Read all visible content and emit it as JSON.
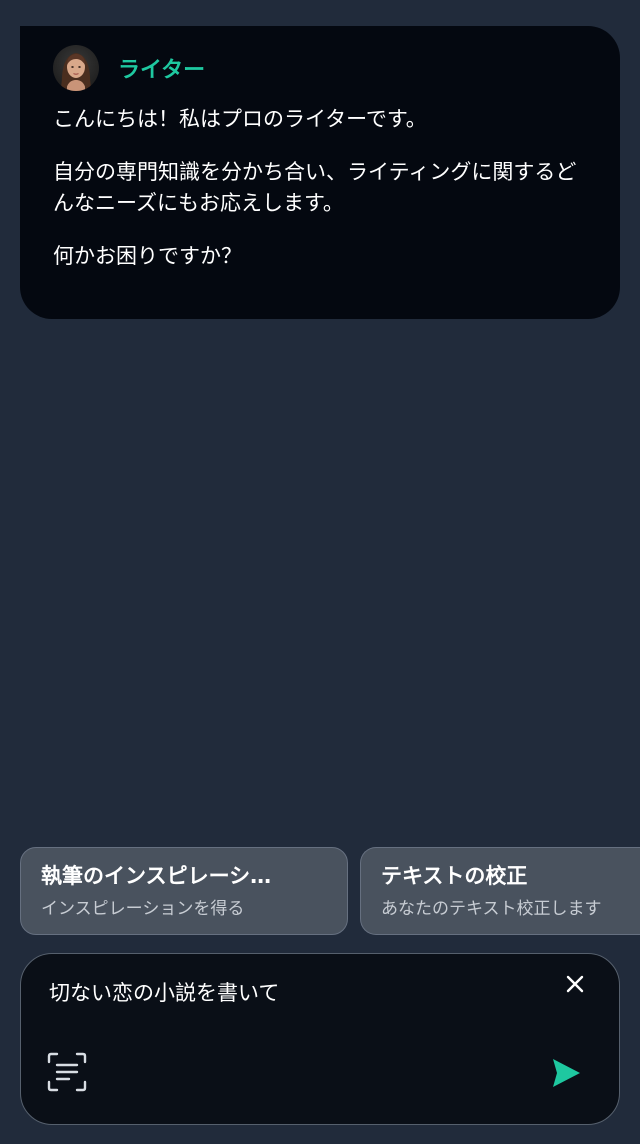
{
  "colors": {
    "background": "#212b3b",
    "bubble": "#040810",
    "accent": "#1ec8a0",
    "chip": "#49525e",
    "composer": "#0a0f17"
  },
  "bot": {
    "name": "ライター",
    "avatar_icon": "woman-portrait-avatar"
  },
  "message": {
    "paragraphs": [
      "こんにちは！私はプロのライターです。",
      "自分の専門知識を分かち合い、ライティングに関するどんなニーズにもお応えします。",
      "何かお困りですか？"
    ]
  },
  "suggestions": [
    {
      "title": "執筆のインスピレーシ…",
      "subtitle": "インスピレーションを得る"
    },
    {
      "title": "テキストの校正",
      "subtitle": "あなたのテキスト校正します"
    }
  ],
  "composer": {
    "value": "切ない恋の小説を書いて",
    "close_icon": "close-icon",
    "scan_icon": "scan-text-icon",
    "send_icon": "send-icon"
  }
}
